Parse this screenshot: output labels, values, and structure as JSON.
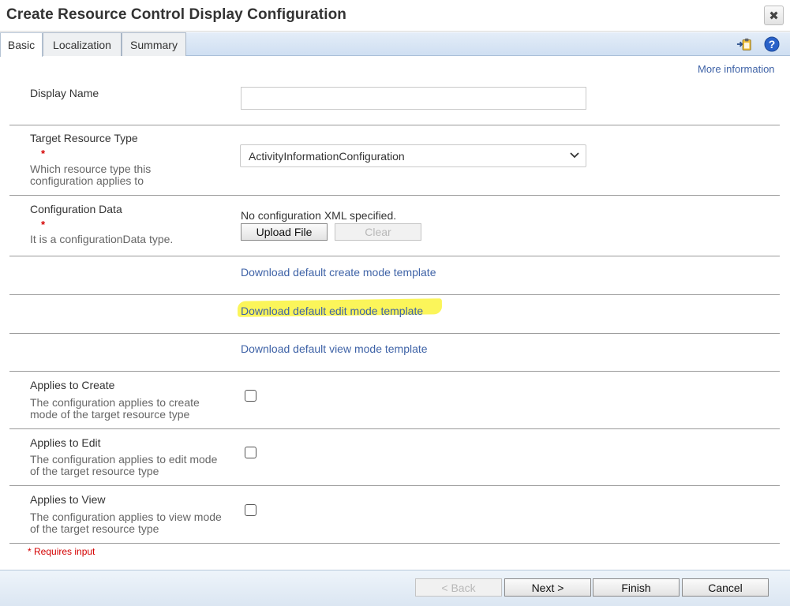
{
  "dialog": {
    "title": "Create Resource Control Display Configuration",
    "close_glyph": "✖"
  },
  "tabs": [
    {
      "label": "Basic",
      "active": true
    },
    {
      "label": "Localization",
      "active": false
    },
    {
      "label": "Summary",
      "active": false
    }
  ],
  "toolbar_icons": [
    "clipboard-arrow-icon",
    "help-icon"
  ],
  "more_information": "More information",
  "fields": {
    "display_name": {
      "label": "Display Name",
      "value": ""
    },
    "target_resource_type": {
      "label": "Target Resource Type",
      "required_mark": "*",
      "description": "Which resource type this configuration applies to",
      "selected": "ActivityInformationConfiguration"
    },
    "configuration_data": {
      "label": "Configuration Data",
      "required_mark": "*",
      "description": "It is a configurationData type.",
      "status": "No configuration XML specified.",
      "upload_label": "Upload File",
      "clear_label": "Clear"
    }
  },
  "links": {
    "create_template": "Download default create mode template",
    "edit_template": "Download default edit mode template",
    "view_template": "Download default view mode template"
  },
  "applies": {
    "create": {
      "label": "Applies to Create",
      "description": "The configuration applies to create mode of the target resource type",
      "checked": false
    },
    "edit": {
      "label": "Applies to Edit",
      "description": "The configuration applies to edit mode of the target resource type",
      "checked": false
    },
    "view": {
      "label": "Applies to View",
      "description": "The configuration applies to view mode of the target resource type",
      "checked": false
    }
  },
  "requires_input_note": "* Requires input",
  "footer": {
    "back": "< Back",
    "next": "Next >",
    "finish": "Finish",
    "cancel": "Cancel"
  },
  "colors": {
    "link": "#3f63a7",
    "required": "#d40000",
    "highlight": "#fbf55a",
    "tabbar": "#cfdff2"
  }
}
